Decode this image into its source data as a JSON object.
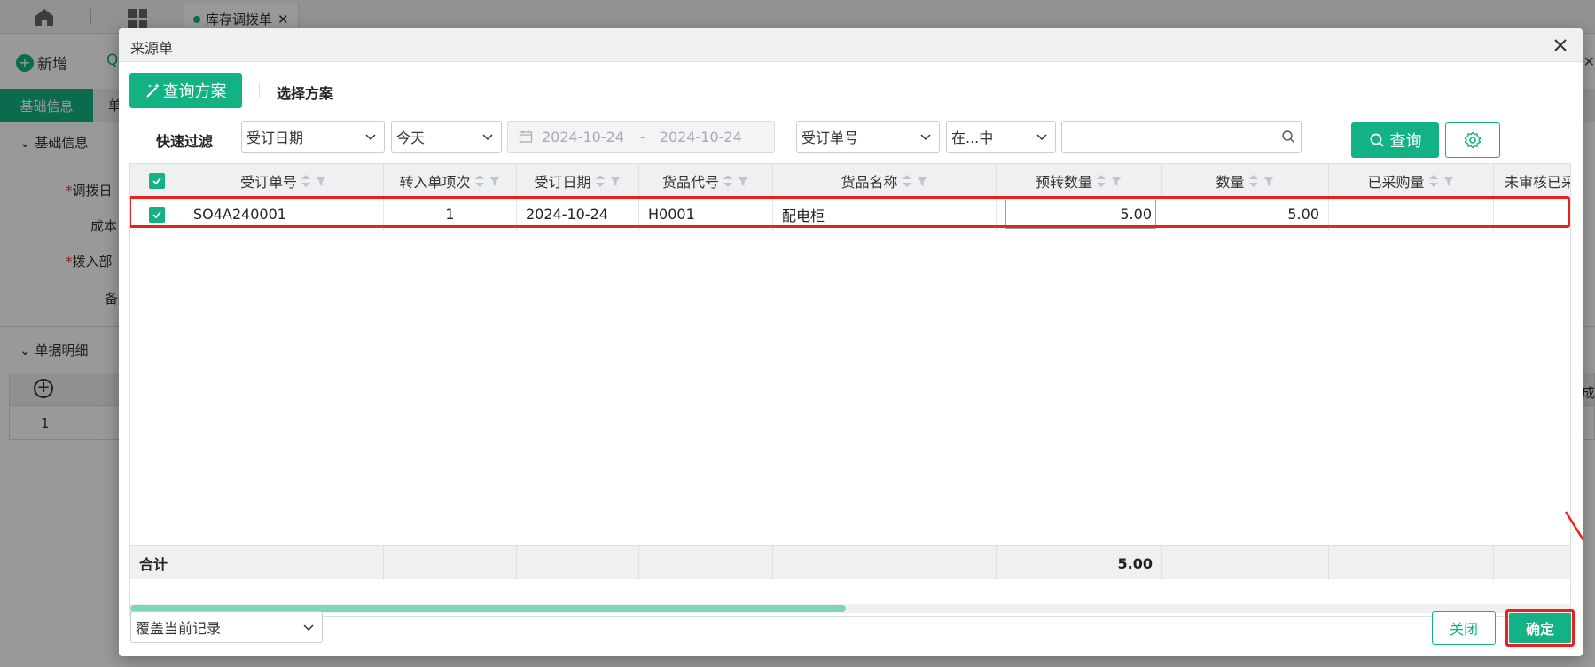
{
  "background": {
    "tab_label": "库存调拨单",
    "new_label": "新增",
    "tab_basic": "基础信息",
    "tab_second": "单",
    "section_basic": "基础信息",
    "field_transfer_date": "调拨日",
    "field_cost": "成本",
    "field_in_dept": "拨入部",
    "field_remark": "备",
    "section_detail": "单据明细",
    "row_number": "1",
    "right_text": "成"
  },
  "dialog": {
    "title": "来源单",
    "query_scheme_label": "查询方案",
    "select_scheme_label": "选择方案",
    "quick_filter_label": "快速过滤",
    "filter1": {
      "field": "受订日期",
      "period": "今天",
      "date_from": "2024-10-24",
      "date_sep": "-",
      "date_to": "2024-10-24"
    },
    "filter2": {
      "field": "受订单号",
      "op": "在...中",
      "value": ""
    },
    "query_button": "查询",
    "columns": [
      "受订单号",
      "转入单项次",
      "受订日期",
      "货品代号",
      "货品名称",
      "预转数量",
      "数量",
      "已采购量",
      "未审核已采"
    ],
    "rows": [
      {
        "order_no": "SO4A240001",
        "item_seq": "1",
        "order_date": "2024-10-24",
        "product_code": "H0001",
        "product_name": "配电柜",
        "pre_qty": "5.00",
        "qty": "5.00",
        "purchased": "",
        "unaudited": ""
      }
    ],
    "total_label": "合计",
    "total_qty": "5.00",
    "mode_select": "覆盖当前记录",
    "close_button": "关闭",
    "confirm_button": "确定"
  },
  "colors": {
    "accent": "#12b284",
    "highlight": "#e8231d"
  },
  "icons": [
    "close-icon",
    "magic-wand-icon",
    "chevron-down-icon",
    "calendar-icon",
    "search-icon",
    "gear-icon",
    "sort-icon",
    "filter-icon",
    "check-icon"
  ]
}
